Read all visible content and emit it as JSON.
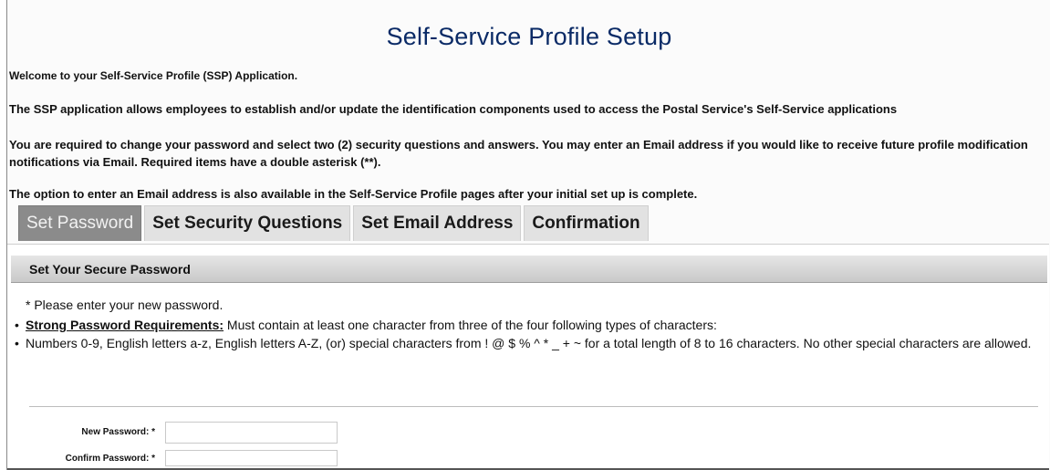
{
  "header": {
    "title": "Self-Service Profile Setup"
  },
  "intro": {
    "welcome": "Welcome to your Self-Service Profile (SSP) Application.",
    "allows": "The SSP application allows employees to establish and/or update the identification components used to access the Postal Service's Self-Service applications",
    "required": "You are required to change your password and select two (2) security questions and answers. You may enter an Email address if you would like to receive future profile modification notifications via Email. Required items have a double asterisk (**).",
    "option": "The option to enter an Email address is also available in the Self-Service Profile pages after your initial set up is complete."
  },
  "tabs": [
    {
      "label": "Set Password",
      "active": true
    },
    {
      "label": "Set Security Questions",
      "active": false
    },
    {
      "label": "Set Email Address",
      "active": false
    },
    {
      "label": "Confirmation",
      "active": false
    }
  ],
  "panel": {
    "header": "Set Your Secure Password",
    "instruction": "* Please enter your new password.",
    "requirements_label": "Strong Password Requirements:",
    "requirements_text": " Must contain at least one character from three of the four following types of characters:",
    "types_text": "Numbers 0-9, English letters a-z, English letters A-Z, (or) special characters from ! @ $ % ^ * _ + ~ for a total length of 8 to 16 characters. No other special characters are allowed."
  },
  "form": {
    "new_password_label": "New Password: *",
    "new_password_value": "",
    "confirm_password_label": "Confirm Password: *",
    "confirm_password_value": ""
  },
  "colors": {
    "title": "#0a2a66",
    "active_tab": "#8b8b8b",
    "inactive_tab": "#e2e2e2"
  }
}
